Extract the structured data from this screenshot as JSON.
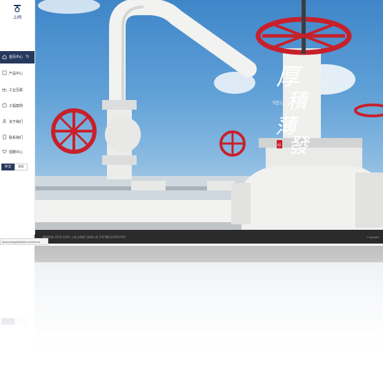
{
  "brand": {
    "logo_text": "上阀"
  },
  "sidebar": {
    "active_item": {
      "label": "首页中心",
      "icon": "home-icon"
    },
    "items": [
      {
        "label": "产品中心",
        "icon": "product-icon"
      },
      {
        "label": "工业互联",
        "icon": "industry-icon"
      },
      {
        "label": "工程案例",
        "icon": "case-icon"
      },
      {
        "label": "关于我们",
        "icon": "about-icon"
      },
      {
        "label": "联系我们",
        "icon": "contact-icon"
      },
      {
        "label": "招聘中心",
        "icon": "recruit-icon"
      }
    ]
  },
  "language": {
    "cn": "中文",
    "en": "EN"
  },
  "hero": {
    "headline": [
      "厚",
      "積",
      "薄",
      "發"
    ],
    "subtext": "百年匠心",
    "seal": "印"
  },
  "footer": {
    "left_text": "版权所有 2019-2020 上海上阀阀门有限公司 沪ICP备12345678号",
    "right_text": "Copyright"
  },
  "status_url": "www.shanghaivalve.com/home",
  "colors": {
    "nav_active": "#26395c",
    "valve_red": "#c8202a",
    "pipe_white": "#f2f2f0",
    "footer_bg": "#2b2b2b"
  }
}
